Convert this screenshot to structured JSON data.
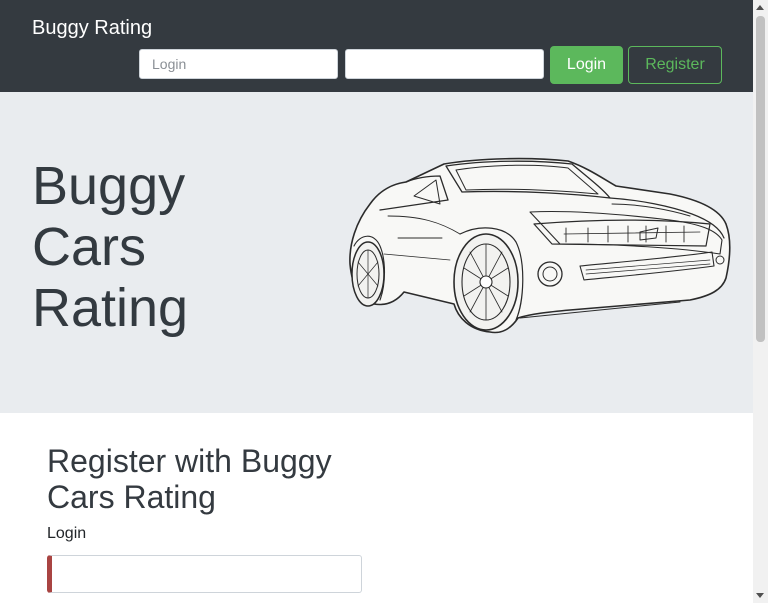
{
  "navbar": {
    "brand": "Buggy Rating",
    "login_placeholder": "Login",
    "password_placeholder": "",
    "login_button": "Login",
    "register_button": "Register"
  },
  "hero": {
    "title_lines": [
      "Buggy",
      "Cars",
      "Rating"
    ],
    "image_icon": "car-sketch-icon"
  },
  "register_form": {
    "title": "Register with Buggy Cars Rating",
    "login_label": "Login",
    "login_value": ""
  },
  "colors": {
    "navbar_bg": "#343a40",
    "hero_bg": "#e9ecef",
    "success": "#5cb85c",
    "invalid_border": "#a94442"
  }
}
